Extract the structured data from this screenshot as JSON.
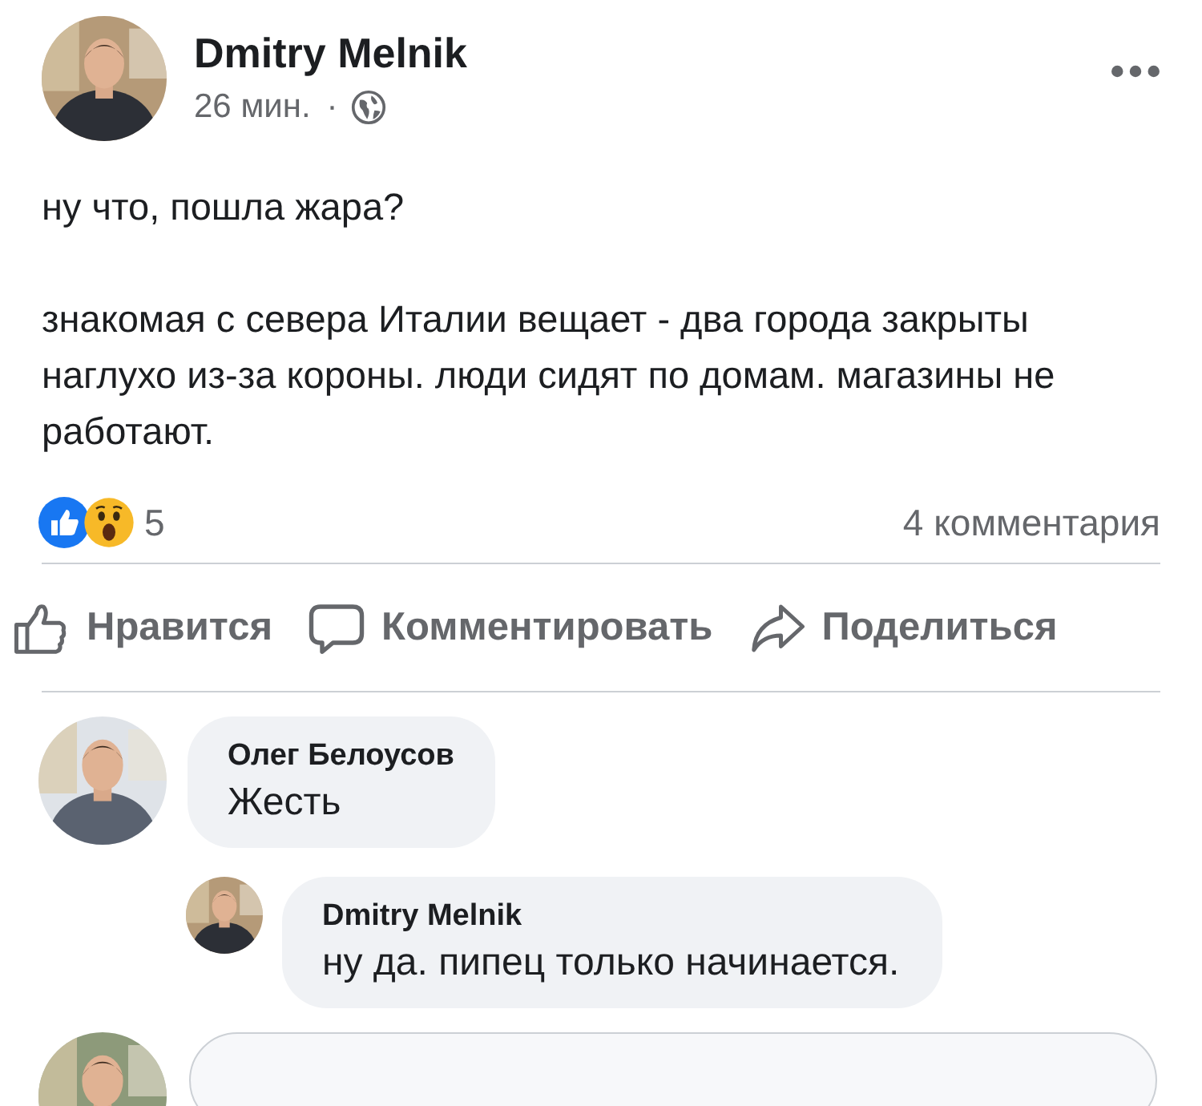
{
  "post": {
    "author": "Dmitry Melnik",
    "time": "26 мин.",
    "dot": "·",
    "paragraphs": [
      "ну что, пошла жара?",
      "знакомая с севера Италии вещает - два города закрыты наглухо из-за короны. люди сидят по домам. магазины не работают."
    ]
  },
  "reactions": {
    "count": "5",
    "comments": "4 комментария"
  },
  "actions": [
    {
      "kind": "like",
      "label": "Нравится"
    },
    {
      "kind": "comment",
      "label": "Комментировать"
    },
    {
      "kind": "share",
      "label": "Поделиться"
    }
  ],
  "comments": [
    {
      "author": "Олег Белоусов",
      "text": "Жесть",
      "reply": false
    },
    {
      "author": "Dmitry Melnik",
      "text": "ну да. пипец только начинается.",
      "reply": true
    }
  ]
}
